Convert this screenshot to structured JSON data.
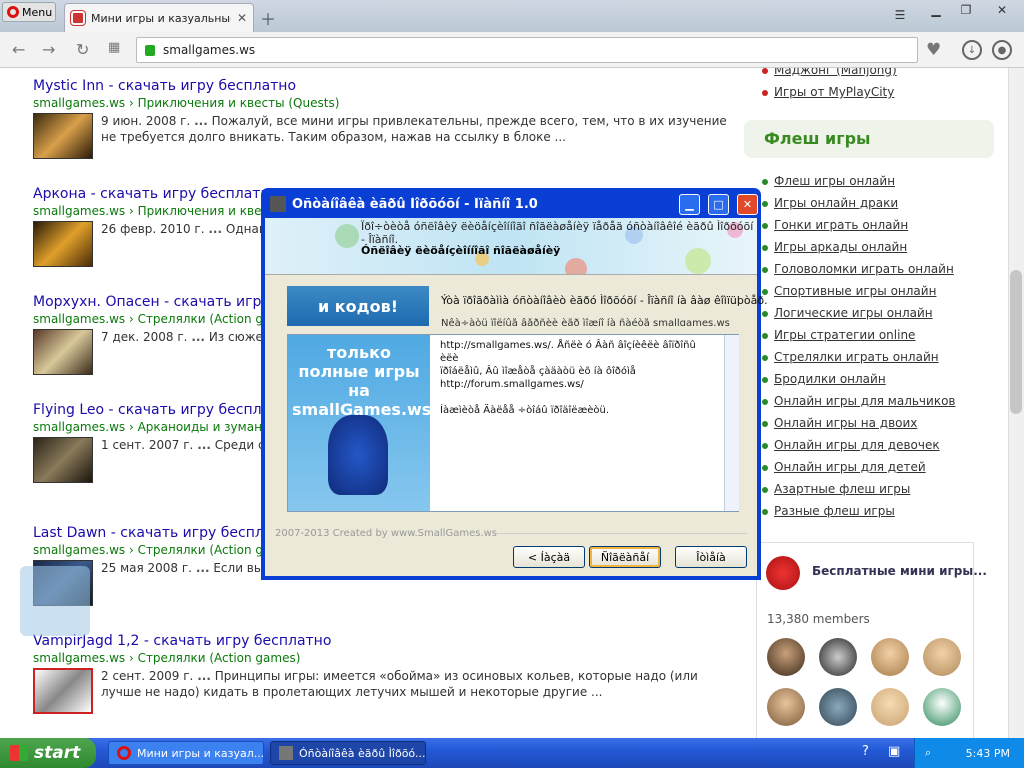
{
  "browser": {
    "menu_label": "Menu",
    "tab_title": "Мини игры и казуальные иг",
    "address": "smallgames.ws"
  },
  "results": [
    {
      "title": "Mystic Inn - скачать игру бесплатно",
      "url": "smallgames.ws › Приключения и квесты (Quests)",
      "date": "9 июн. 2008 г.",
      "snippet": "Пожалуй, все мини игры привлекательны, прежде всего, тем, что в их изучение не требуется долго вникать. Таким образом, нажав на ссылку в блоке ..."
    },
    {
      "title": "Аркона - скачать игру бесплатно",
      "url": "smallgames.ws › Приключения и квесты",
      "date": "26 февр. 2010 г.",
      "snippet": "Однако ... Artefact Известно, что казу"
    },
    {
      "title": "Морхухн. Опасен - скачать игру",
      "url": "smallgames.ws › Стрелялки (Action games)",
      "date": "7 дек. 2008 г.",
      "snippet": "Из сюжет ... Западе. Но без ковбойски"
    },
    {
      "title": "Flying Leo - скачать игру бесплатно",
      "url": "smallgames.ws › Арканоиды и зумано",
      "date": "1 сент. 2007 г.",
      "snippet": "Среди су ... место занимают различны"
    },
    {
      "title": "Last Dawn - скачать игру бесплатно",
      "url": "smallgames.ws › Стрелялки (Action games)",
      "date": "25 мая 2008 г.",
      "snippet": "Если вы ... загрузив без регистрации Last Dawn в разделе Стрелялки (Action ..."
    },
    {
      "title": "VampirJagd 1,2 - скачать игру бесплатно",
      "url": "smallgames.ws › Стрелялки (Action games)",
      "date": "2 сент. 2009 г.",
      "snippet": "Принципы игры: имеется «обойма» из осиновых кольев, которые надо (или лучше не надо) кидать в пролетающих летучих мышей и некоторые другие ..."
    }
  ],
  "right": {
    "top_links": [
      "Маджонг (Mahjong)",
      "Игры от MyPlayCity"
    ],
    "flash_header": "Флеш игры",
    "flash_links": [
      "Флеш игры онлайн",
      "Игры онлайн драки",
      "Гонки играть онлайн",
      "Игры аркады онлайн",
      "Головоломки играть онлайн",
      "Спортивные игры онлайн",
      "Логические игры онлайн",
      "Игры стратегии online",
      "Стрелялки играть онлайн",
      "Бродилки онлайн",
      "Онлайн игры для мальчиков",
      "Онлайн игры на двоих",
      "Онлайн игры для девочек",
      "Онлайн игры для детей",
      "Азартные флеш игры",
      "Разные флеш игры"
    ],
    "fb_title": "Бесплатные мини игры...",
    "members": "13,380 members"
  },
  "dialog": {
    "title": "Óñòàíîâêà èãðû Ìîðõóõí - Îïàñíî 1.0",
    "head_line1": "Ïðî÷òèòå óñëîâèÿ ëèöåíçèîííîãî ñîãëàøåíèÿ ïåðåä óñòàíîâêîé èãðû Ìîðõóõí",
    "head_line1b": "- Îïàñíî.",
    "head_line2": "Óñëîâèÿ ëèöåíçèîííîãî ñîãëàøåíèÿ",
    "banner": "и кодов!",
    "banner_text": "Ýòà ïðîãðàììà óñòàíîâèò èãðó Ìîðõóõí - Îïàñíî íà âàø êîìïüþòåð.",
    "banner_text2": "Ñêà÷àòü ïîëíûå âåðñèè èãð ìîæíî íà ñàéòå smallgames.ws",
    "promo": "только полные игры на smallGames.ws",
    "license_lines": [
      "http://smallgames.ws/. Åñëè ó Âàñ âîçíèêëè âîïðîñû èëè",
      "ïðîáëåìû, Âû ìîæåòå çàäàòü èõ íà ôîðóìå",
      "http://forum.smallgames.ws/",
      "",
      "Íàæìèòå Äàëåå ÷òîáû ïðîäîëæèòü."
    ],
    "credit": "2007-2013 Created by www.SmallGames.ws",
    "back": "< Íàçàä",
    "next": "Ñîãëàñåí",
    "cancel": "Îòìåíà"
  },
  "taskbar": {
    "start": "start",
    "task1": "Мини игры и казуал...",
    "task2": "Óñòàíîâêà èãðû Ìîðõó...",
    "clock": "5:43 PM"
  }
}
